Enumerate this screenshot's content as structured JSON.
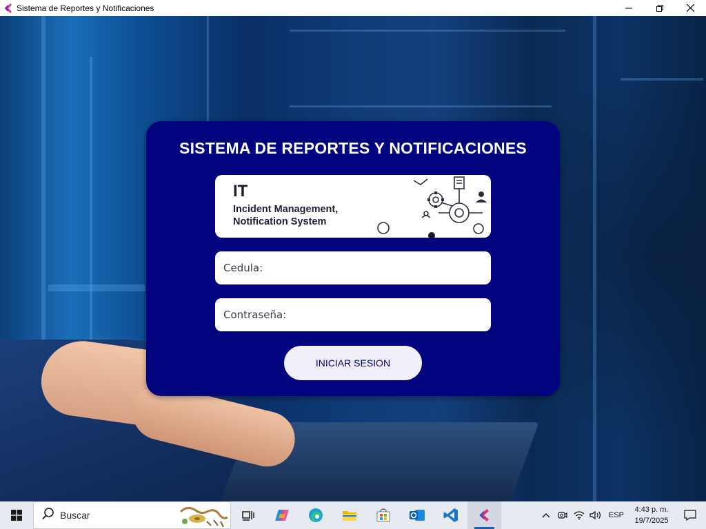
{
  "window": {
    "title": "Sistema de Reportes y Notificaciones",
    "controls": {
      "minimize": "─",
      "maximize": "❐",
      "close": "✕"
    }
  },
  "login": {
    "heading": "SISTEMA DE REPORTES Y NOTIFICACIONES",
    "banner": {
      "title": "IT",
      "subtitle_line1": "Incident Management,",
      "subtitle_line2": "Notification System"
    },
    "cedula_field": {
      "value": "Cedula:"
    },
    "password_field": {
      "value": "Contraseña:"
    },
    "login_button": "INICIAR SESION"
  },
  "taskbar": {
    "search_label": "Buscar",
    "apps": [
      {
        "icon": "task-view-icon"
      },
      {
        "icon": "copilot-icon"
      },
      {
        "icon": "edge-icon"
      },
      {
        "icon": "file-explorer-icon"
      },
      {
        "icon": "store-icon"
      },
      {
        "icon": "outlook-icon"
      },
      {
        "icon": "vscode-icon"
      },
      {
        "icon": "app-icon",
        "active": true
      }
    ],
    "tray": {
      "language": "ESP",
      "time": "4:43 p. m.",
      "date": "19/7/2025"
    }
  },
  "colors": {
    "panel": "#02037e",
    "button_bg": "#f1f0fa",
    "button_text": "#020371",
    "taskbar": "#e7eaf0"
  }
}
